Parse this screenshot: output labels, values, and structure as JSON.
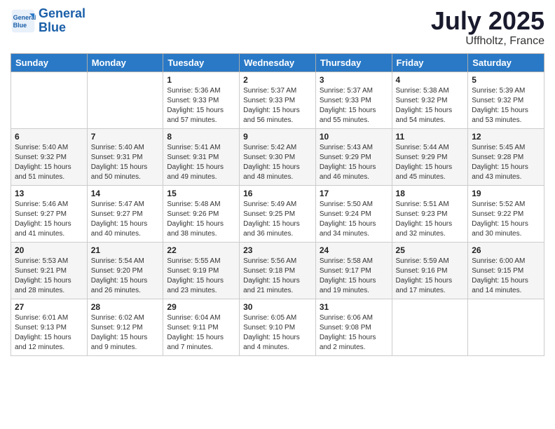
{
  "logo": {
    "line1": "General",
    "line2": "Blue"
  },
  "title": "July 2025",
  "location": "Uffholtz, France",
  "weekdays": [
    "Sunday",
    "Monday",
    "Tuesday",
    "Wednesday",
    "Thursday",
    "Friday",
    "Saturday"
  ],
  "weeks": [
    [
      {
        "day": "",
        "sunrise": "",
        "sunset": "",
        "daylight": ""
      },
      {
        "day": "",
        "sunrise": "",
        "sunset": "",
        "daylight": ""
      },
      {
        "day": "1",
        "sunrise": "Sunrise: 5:36 AM",
        "sunset": "Sunset: 9:33 PM",
        "daylight": "Daylight: 15 hours and 57 minutes."
      },
      {
        "day": "2",
        "sunrise": "Sunrise: 5:37 AM",
        "sunset": "Sunset: 9:33 PM",
        "daylight": "Daylight: 15 hours and 56 minutes."
      },
      {
        "day": "3",
        "sunrise": "Sunrise: 5:37 AM",
        "sunset": "Sunset: 9:33 PM",
        "daylight": "Daylight: 15 hours and 55 minutes."
      },
      {
        "day": "4",
        "sunrise": "Sunrise: 5:38 AM",
        "sunset": "Sunset: 9:32 PM",
        "daylight": "Daylight: 15 hours and 54 minutes."
      },
      {
        "day": "5",
        "sunrise": "Sunrise: 5:39 AM",
        "sunset": "Sunset: 9:32 PM",
        "daylight": "Daylight: 15 hours and 53 minutes."
      }
    ],
    [
      {
        "day": "6",
        "sunrise": "Sunrise: 5:40 AM",
        "sunset": "Sunset: 9:32 PM",
        "daylight": "Daylight: 15 hours and 51 minutes."
      },
      {
        "day": "7",
        "sunrise": "Sunrise: 5:40 AM",
        "sunset": "Sunset: 9:31 PM",
        "daylight": "Daylight: 15 hours and 50 minutes."
      },
      {
        "day": "8",
        "sunrise": "Sunrise: 5:41 AM",
        "sunset": "Sunset: 9:31 PM",
        "daylight": "Daylight: 15 hours and 49 minutes."
      },
      {
        "day": "9",
        "sunrise": "Sunrise: 5:42 AM",
        "sunset": "Sunset: 9:30 PM",
        "daylight": "Daylight: 15 hours and 48 minutes."
      },
      {
        "day": "10",
        "sunrise": "Sunrise: 5:43 AM",
        "sunset": "Sunset: 9:29 PM",
        "daylight": "Daylight: 15 hours and 46 minutes."
      },
      {
        "day": "11",
        "sunrise": "Sunrise: 5:44 AM",
        "sunset": "Sunset: 9:29 PM",
        "daylight": "Daylight: 15 hours and 45 minutes."
      },
      {
        "day": "12",
        "sunrise": "Sunrise: 5:45 AM",
        "sunset": "Sunset: 9:28 PM",
        "daylight": "Daylight: 15 hours and 43 minutes."
      }
    ],
    [
      {
        "day": "13",
        "sunrise": "Sunrise: 5:46 AM",
        "sunset": "Sunset: 9:27 PM",
        "daylight": "Daylight: 15 hours and 41 minutes."
      },
      {
        "day": "14",
        "sunrise": "Sunrise: 5:47 AM",
        "sunset": "Sunset: 9:27 PM",
        "daylight": "Daylight: 15 hours and 40 minutes."
      },
      {
        "day": "15",
        "sunrise": "Sunrise: 5:48 AM",
        "sunset": "Sunset: 9:26 PM",
        "daylight": "Daylight: 15 hours and 38 minutes."
      },
      {
        "day": "16",
        "sunrise": "Sunrise: 5:49 AM",
        "sunset": "Sunset: 9:25 PM",
        "daylight": "Daylight: 15 hours and 36 minutes."
      },
      {
        "day": "17",
        "sunrise": "Sunrise: 5:50 AM",
        "sunset": "Sunset: 9:24 PM",
        "daylight": "Daylight: 15 hours and 34 minutes."
      },
      {
        "day": "18",
        "sunrise": "Sunrise: 5:51 AM",
        "sunset": "Sunset: 9:23 PM",
        "daylight": "Daylight: 15 hours and 32 minutes."
      },
      {
        "day": "19",
        "sunrise": "Sunrise: 5:52 AM",
        "sunset": "Sunset: 9:22 PM",
        "daylight": "Daylight: 15 hours and 30 minutes."
      }
    ],
    [
      {
        "day": "20",
        "sunrise": "Sunrise: 5:53 AM",
        "sunset": "Sunset: 9:21 PM",
        "daylight": "Daylight: 15 hours and 28 minutes."
      },
      {
        "day": "21",
        "sunrise": "Sunrise: 5:54 AM",
        "sunset": "Sunset: 9:20 PM",
        "daylight": "Daylight: 15 hours and 26 minutes."
      },
      {
        "day": "22",
        "sunrise": "Sunrise: 5:55 AM",
        "sunset": "Sunset: 9:19 PM",
        "daylight": "Daylight: 15 hours and 23 minutes."
      },
      {
        "day": "23",
        "sunrise": "Sunrise: 5:56 AM",
        "sunset": "Sunset: 9:18 PM",
        "daylight": "Daylight: 15 hours and 21 minutes."
      },
      {
        "day": "24",
        "sunrise": "Sunrise: 5:58 AM",
        "sunset": "Sunset: 9:17 PM",
        "daylight": "Daylight: 15 hours and 19 minutes."
      },
      {
        "day": "25",
        "sunrise": "Sunrise: 5:59 AM",
        "sunset": "Sunset: 9:16 PM",
        "daylight": "Daylight: 15 hours and 17 minutes."
      },
      {
        "day": "26",
        "sunrise": "Sunrise: 6:00 AM",
        "sunset": "Sunset: 9:15 PM",
        "daylight": "Daylight: 15 hours and 14 minutes."
      }
    ],
    [
      {
        "day": "27",
        "sunrise": "Sunrise: 6:01 AM",
        "sunset": "Sunset: 9:13 PM",
        "daylight": "Daylight: 15 hours and 12 minutes."
      },
      {
        "day": "28",
        "sunrise": "Sunrise: 6:02 AM",
        "sunset": "Sunset: 9:12 PM",
        "daylight": "Daylight: 15 hours and 9 minutes."
      },
      {
        "day": "29",
        "sunrise": "Sunrise: 6:04 AM",
        "sunset": "Sunset: 9:11 PM",
        "daylight": "Daylight: 15 hours and 7 minutes."
      },
      {
        "day": "30",
        "sunrise": "Sunrise: 6:05 AM",
        "sunset": "Sunset: 9:10 PM",
        "daylight": "Daylight: 15 hours and 4 minutes."
      },
      {
        "day": "31",
        "sunrise": "Sunrise: 6:06 AM",
        "sunset": "Sunset: 9:08 PM",
        "daylight": "Daylight: 15 hours and 2 minutes."
      },
      {
        "day": "",
        "sunrise": "",
        "sunset": "",
        "daylight": ""
      },
      {
        "day": "",
        "sunrise": "",
        "sunset": "",
        "daylight": ""
      }
    ]
  ]
}
